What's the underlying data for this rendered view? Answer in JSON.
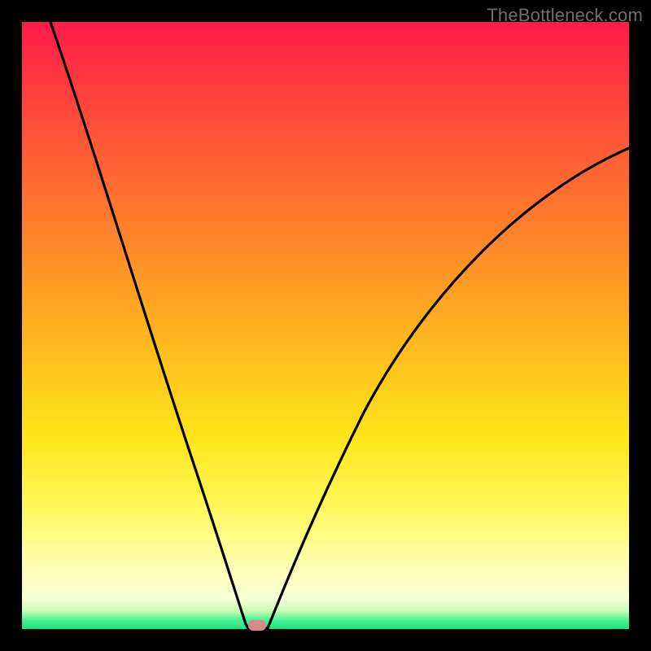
{
  "watermark": "TheBottleneck.com",
  "colors": {
    "curve_stroke": "#000000",
    "marker_fill": "#d68b86"
  },
  "chart_data": {
    "type": "line",
    "title": "",
    "xlabel": "",
    "ylabel": "",
    "xlim": [
      0,
      100
    ],
    "ylim": [
      0,
      100
    ],
    "x": [
      0,
      2,
      4,
      6,
      8,
      10,
      12,
      14,
      16,
      18,
      20,
      22,
      24,
      26,
      28,
      30,
      32,
      34,
      36,
      37,
      38,
      39,
      40,
      42,
      44,
      46,
      48,
      50,
      55,
      60,
      65,
      70,
      75,
      80,
      85,
      90,
      95,
      100
    ],
    "y": [
      100,
      94,
      88,
      82,
      76,
      70,
      63,
      56,
      49,
      42,
      36,
      30,
      24,
      18,
      13,
      9,
      6,
      3,
      1,
      0,
      0,
      0,
      1,
      3,
      6,
      9,
      13,
      17,
      27,
      36,
      44,
      51,
      57,
      63,
      68,
      72,
      76,
      79
    ],
    "marker": {
      "x": 38,
      "y": 0
    },
    "grid": false,
    "legend": false
  }
}
